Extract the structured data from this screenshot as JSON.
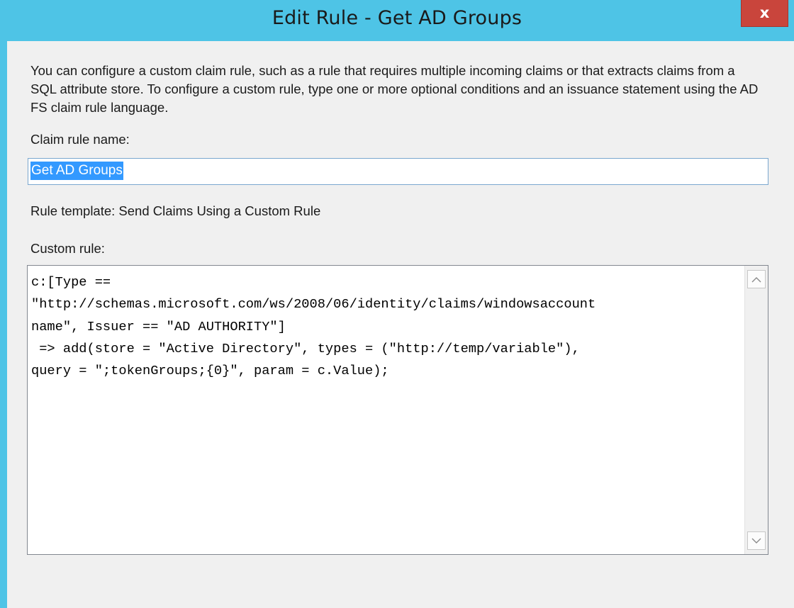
{
  "window": {
    "title": "Edit Rule - Get AD Groups",
    "close_label": "x"
  },
  "dialog": {
    "description": "You can configure a custom claim rule, such as a rule that requires multiple incoming claims or that extracts claims from a SQL attribute store. To configure a custom rule, type one or more optional conditions and an issuance statement using the AD FS claim rule language.",
    "claim_rule_name_label": "Claim rule name:",
    "claim_rule_name_value": "Get AD Groups",
    "rule_template_label": "Rule template: Send Claims Using a Custom Rule",
    "custom_rule_label": "Custom rule:",
    "custom_rule_lines": [
      "c:[Type ==",
      "\"http://schemas.microsoft.com/ws/2008/06/identity/claims/windowsaccount",
      "name\", Issuer == \"AD AUTHORITY\"]",
      " => add(store = \"Active Directory\", types = (\"http://temp/variable\"),",
      "query = \";tokenGroups;{0}\", param = c.Value);"
    ]
  },
  "icons": {
    "close": "close-icon",
    "scroll_up": "chevron-up-icon",
    "scroll_down": "chevron-down-icon"
  },
  "colors": {
    "titlebar": "#4ec4e6",
    "close_button": "#c9453c",
    "selection": "#3399ff",
    "dialog_background": "#f0f0f0"
  }
}
